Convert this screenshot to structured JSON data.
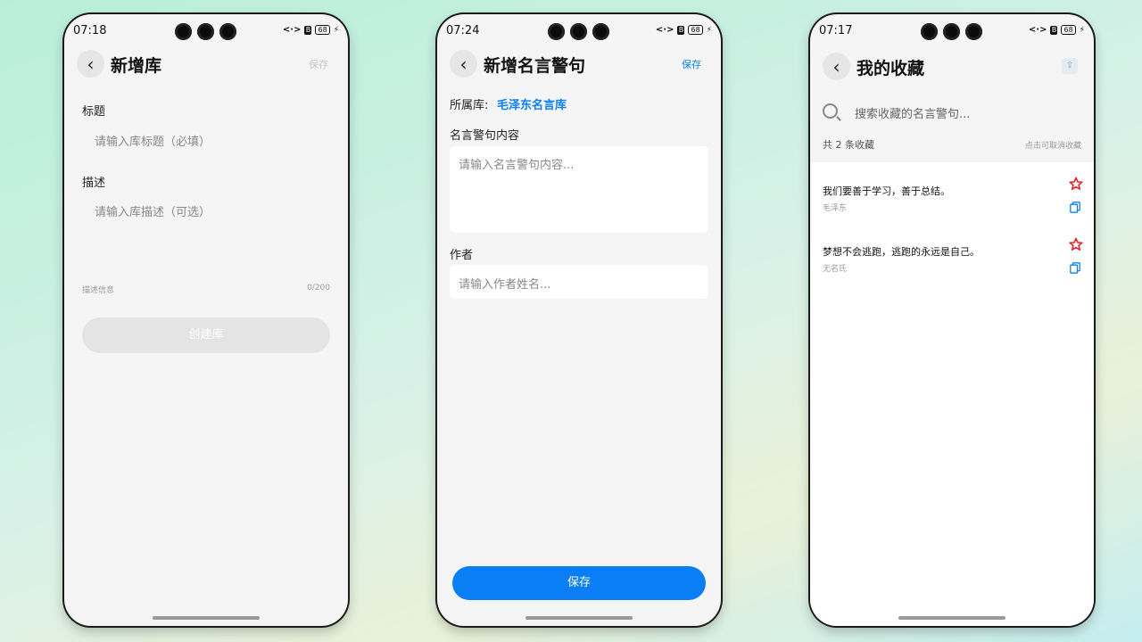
{
  "phone1": {
    "status": {
      "time": "07:18",
      "battery": "68"
    },
    "title": "新增库",
    "save": "保存",
    "title_label": "标题",
    "title_placeholder": "请输入库标题（必填）",
    "desc_label": "描述",
    "desc_placeholder": "请输入库描述（可选）",
    "desc_info": "描述信息",
    "desc_count": "0/200",
    "create_button": "创建库"
  },
  "phone2": {
    "status": {
      "time": "07:24",
      "battery": "68"
    },
    "title": "新增名言警句",
    "save": "保存",
    "library_label": "所属库:",
    "library_value": "毛泽东名言库",
    "content_label": "名言警句内容",
    "content_placeholder": "请输入名言警句内容...",
    "author_label": "作者",
    "author_placeholder": "请输入作者姓名...",
    "save_button": "保存"
  },
  "phone3": {
    "status": {
      "time": "07:17",
      "battery": "68"
    },
    "title": "我的收藏",
    "search_placeholder": "搜索收藏的名言警句...",
    "count_text": "共 2 条收藏",
    "hint_text": "点击可取消收藏",
    "items": [
      {
        "quote": "我们要善于学习，善于总结。",
        "author": "毛泽东"
      },
      {
        "quote": "梦想不会逃跑，逃跑的永远是自己。",
        "author": "无名氏"
      }
    ]
  },
  "colors": {
    "accent": "#0a7ff5",
    "star": "#e8262a",
    "disabled": "#e4e4e4"
  },
  "icons": [
    "back-arrow-icon",
    "search-icon",
    "star-icon",
    "copy-icon",
    "share-icon",
    "camera-icon",
    "battery-icon"
  ]
}
